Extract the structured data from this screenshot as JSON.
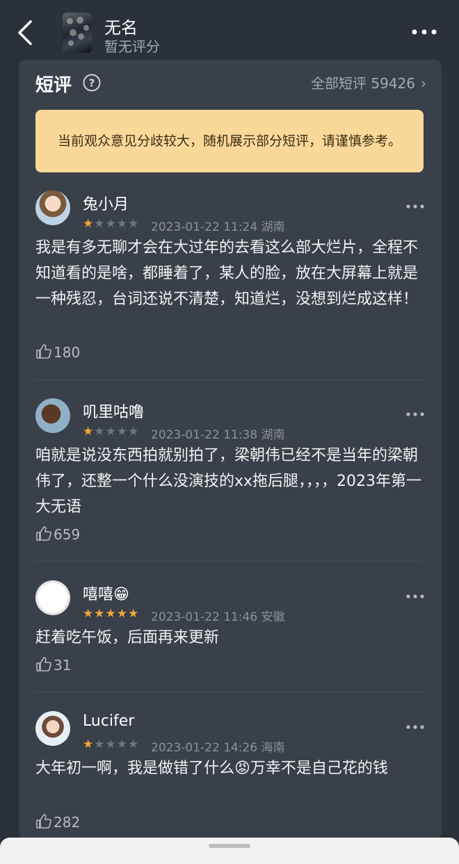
{
  "header": {
    "title": "无名",
    "subtitle": "暂无评分"
  },
  "section": {
    "title": "短评",
    "all_link": "全部短评 59426"
  },
  "notice": "当前观众意见分歧较大，随机展示部分短评，请谨慎参考。",
  "reviews": [
    {
      "user": "兔小月",
      "rating": 1,
      "time": "2023-01-22 11:24",
      "location": "湖南",
      "text": "我是有多无聊才会在大过年的去看这么部大烂片，全程不知道看的是啥，都睡着了，某人的脸，放在大屏幕上就是一种残忍，台词还说不清楚，知道烂，没想到烂成这样！",
      "likes": "180"
    },
    {
      "user": "叽里咕噜",
      "rating": 1,
      "time": "2023-01-22 11:38",
      "location": "湖南",
      "text": "咱就是说没东西拍就别拍了，梁朝伟已经不是当年的梁朝伟了，还整一个什么没演技的xx拖后腿，，，，2023年第一大无语",
      "likes": "659"
    },
    {
      "user": "嘻嘻😁",
      "rating": 5,
      "time": "2023-01-22 11:46",
      "location": "安徽",
      "text": "赶着吃午饭，后面再来更新",
      "likes": "31"
    },
    {
      "user": "Lucifer",
      "rating": 1,
      "time": "2023-01-22 14:26",
      "location": "海南",
      "text": "大年初一啊，我是做错了什么😡万幸不是自己花的钱",
      "likes": "282"
    }
  ],
  "colors": {
    "background": "#2b3139",
    "panel": "#3a4049",
    "notice": "#f9d89a",
    "star": "#f3a536"
  }
}
